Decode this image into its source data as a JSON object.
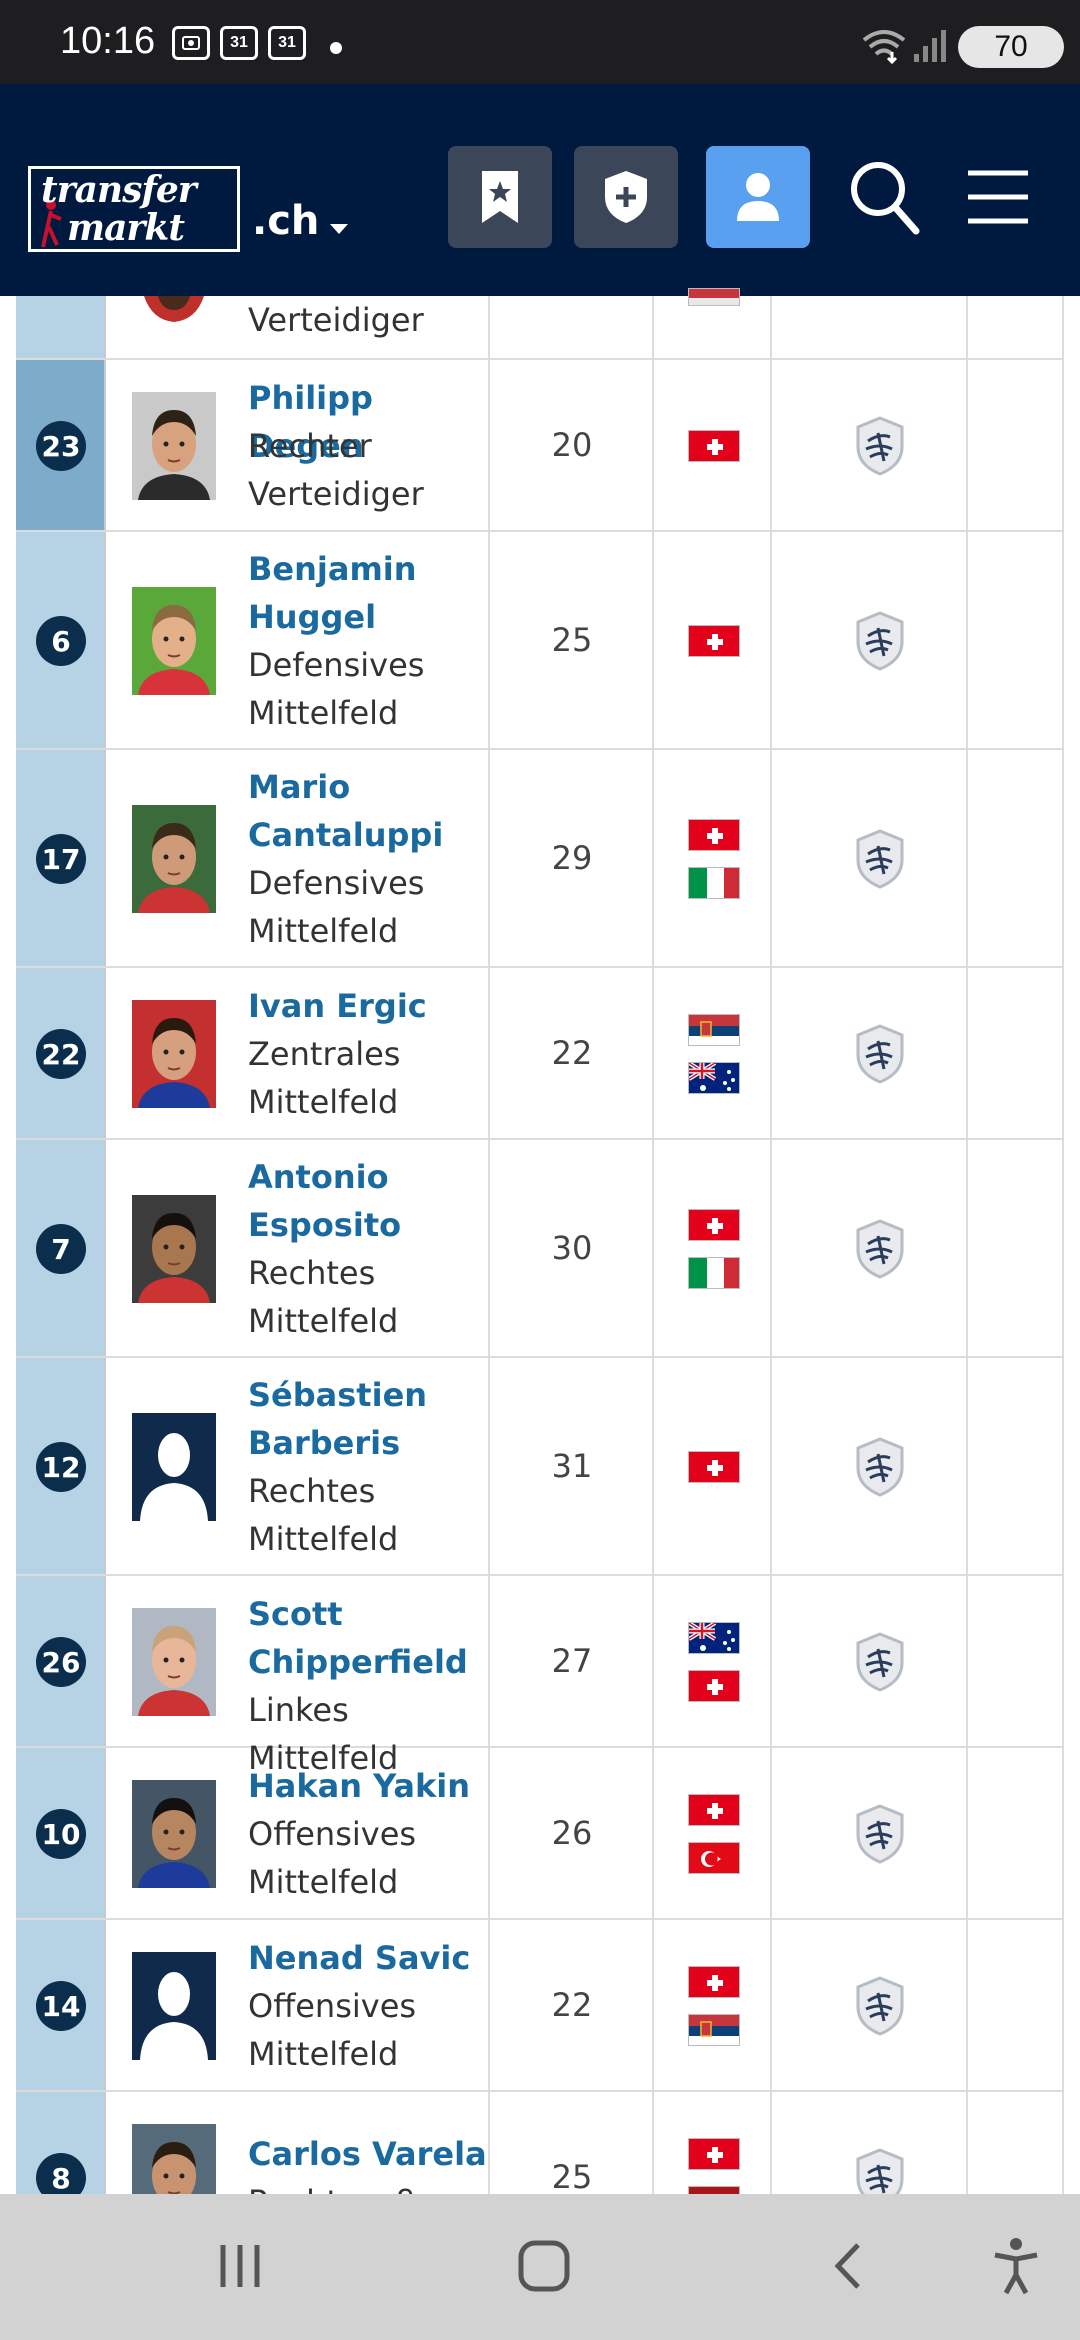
{
  "status_bar": {
    "time": "10:16",
    "notif_icons": [
      "screenshot-icon",
      "calendar-31",
      "calendar-31"
    ],
    "cal_text_1": "31",
    "cal_text_2": "31",
    "battery": "70"
  },
  "header": {
    "logo_line1": "transfer",
    "logo_line2": "markt",
    "domain": ".ch",
    "buttons": [
      "bookmark-icon",
      "shield-plus-icon",
      "user-icon",
      "search-icon",
      "menu-icon"
    ]
  },
  "partial_top_row": {
    "position": "Verteidiger"
  },
  "players": [
    {
      "number": "23",
      "name_lines": [
        "Philipp Degen"
      ],
      "pos_lines": [
        "Rechter",
        "Verteidiger"
      ],
      "age": "20",
      "flags": [
        "ch"
      ]
    },
    {
      "number": "6",
      "name_lines": [
        "Benjamin",
        "Huggel"
      ],
      "pos_lines": [
        "Defensives",
        "Mittelfeld"
      ],
      "age": "25",
      "flags": [
        "ch"
      ]
    },
    {
      "number": "17",
      "name_lines": [
        "Mario",
        "Cantaluppi"
      ],
      "pos_lines": [
        "Defensives",
        "Mittelfeld"
      ],
      "age": "29",
      "flags": [
        "ch",
        "it"
      ]
    },
    {
      "number": "22",
      "name_lines": [
        "Ivan Ergic"
      ],
      "pos_lines": [
        "Zentrales",
        "Mittelfeld"
      ],
      "age": "22",
      "flags": [
        "rs",
        "au"
      ]
    },
    {
      "number": "7",
      "name_lines": [
        "Antonio",
        "Esposito"
      ],
      "pos_lines": [
        "Rechtes",
        "Mittelfeld"
      ],
      "age": "30",
      "flags": [
        "ch",
        "it"
      ]
    },
    {
      "number": "12",
      "name_lines": [
        "Sébastien",
        "Barberis"
      ],
      "pos_lines": [
        "Rechtes",
        "Mittelfeld"
      ],
      "age": "31",
      "flags": [
        "ch"
      ]
    },
    {
      "number": "26",
      "name_lines": [
        "Scott",
        "Chipperfield"
      ],
      "pos_lines": [
        "Linkes Mittelfeld"
      ],
      "age": "27",
      "flags": [
        "au",
        "ch"
      ]
    },
    {
      "number": "10",
      "name_lines": [
        "Hakan Yakin"
      ],
      "pos_lines": [
        "Offensives",
        "Mittelfeld"
      ],
      "age": "26",
      "flags": [
        "ch",
        "tr"
      ]
    },
    {
      "number": "14",
      "name_lines": [
        "Nenad Savic"
      ],
      "pos_lines": [
        "Offensives",
        "Mittelfeld"
      ],
      "age": "22",
      "flags": [
        "ch",
        "rs"
      ]
    },
    {
      "number": "8",
      "name_lines": [
        "Carlos Varela"
      ],
      "pos_lines": [
        "Rechtsaußen"
      ],
      "age": "25",
      "flags": [
        "ch",
        "es"
      ]
    }
  ],
  "nav": [
    "recent-apps-icon",
    "home-icon",
    "back-icon",
    "accessibility-icon"
  ],
  "colors": {
    "header_bg": "#00193f",
    "link_blue": "#1a6aa0",
    "number_col": "#b6d3e5",
    "badge": "#0a2e4c"
  }
}
